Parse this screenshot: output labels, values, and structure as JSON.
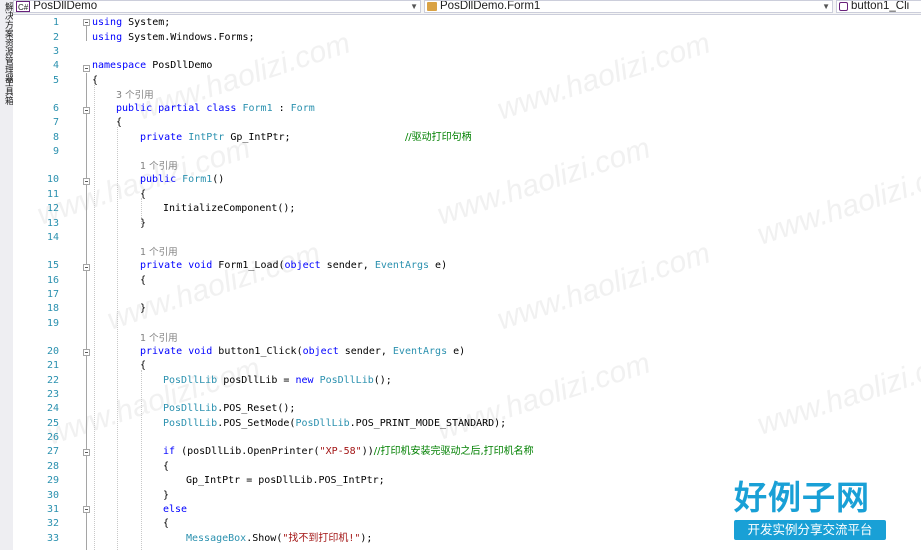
{
  "toolstrip": {
    "labels": [
      "解决方案资源管理器",
      "工具箱"
    ]
  },
  "navbar": {
    "project": {
      "icon": "csharp-project-icon",
      "badge": "C#",
      "label": "PosDllDemo"
    },
    "type": {
      "icon": "class-icon",
      "label": "PosDllDemo.Form1"
    },
    "member": {
      "icon": "event-method-icon",
      "label": "button1_Cli"
    }
  },
  "editor": {
    "line_numbers": [
      "1",
      "2",
      "3",
      "4",
      "5",
      "6",
      "7",
      "8",
      "9",
      "10",
      "11",
      "12",
      "13",
      "14",
      "15",
      "16",
      "17",
      "18",
      "19",
      "20",
      "21",
      "22",
      "23",
      "24",
      "25",
      "26",
      "27",
      "28",
      "29",
      "30",
      "31",
      "32",
      "33"
    ],
    "codelens": [
      "3 个引用",
      "1 个引用",
      "1 个引用",
      "1 个引用"
    ],
    "tokens": {
      "l1a": "using",
      "l1b": " System;",
      "l2a": "using",
      "l2b": " System.Windows.Forms;",
      "l4a": "namespace",
      "l4b": " PosDllDemo",
      "l5": "{",
      "l6a": "public",
      "l6b": " ",
      "l6c": "partial",
      "l6d": " ",
      "l6e": "class",
      "l6f": " ",
      "l6g": "Form1",
      "l6h": " : ",
      "l6i": "Form",
      "l7": "{",
      "l8a": "private",
      "l8b": " ",
      "l8c": "IntPtr",
      "l8d": " Gp_IntPtr;                   ",
      "l8e": "//驱动打印句柄",
      "l10a": "public",
      "l10b": " ",
      "l10c": "Form1",
      "l10d": "()",
      "l11": "{",
      "l12": "InitializeComponent();",
      "l13": "}",
      "l15a": "private",
      "l15b": " ",
      "l15c": "void",
      "l15d": " Form1_Load(",
      "l15e": "object",
      "l15f": " sender, ",
      "l15g": "EventArgs",
      "l15h": " e)",
      "l16": "{",
      "l18": "}",
      "l20a": "private",
      "l20b": " ",
      "l20c": "void",
      "l20d": " button1_Click(",
      "l20e": "object",
      "l20f": " sender, ",
      "l20g": "EventArgs",
      "l20h": " e)",
      "l21": "{",
      "l22a": "PosDllLib",
      "l22b": " posDllLib = ",
      "l22c": "new",
      "l22d": " ",
      "l22e": "PosDllLib",
      "l22f": "();",
      "l24a": "PosDllLib",
      "l24b": ".POS_Reset();",
      "l25a": "PosDllLib",
      "l25b": ".POS_SetMode(",
      "l25c": "PosDllLib",
      "l25d": ".POS_PRINT_MODE_STANDARD);",
      "l27a": "if",
      "l27b": " (posDllLib.OpenPrinter(",
      "l27c": "\"XP-58\"",
      "l27d": "))",
      "l27e": "//打印机安装完驱动之后,打印机名称",
      "l28": "{",
      "l29a": "Gp_IntPtr = ",
      "l29b": "posDllLib",
      "l29c": ".POS_IntPtr;",
      "l30": "}",
      "l31": "else",
      "l32": "{",
      "l33a": "MessageBox",
      "l33b": ".Show(",
      "l33c": "\"找不到打印机!\"",
      "l33d": ");"
    }
  },
  "watermark": {
    "text": "www.haolizi.com"
  },
  "logo": {
    "main": "好例子网",
    "sub": "开发实例分享交流平台"
  },
  "colors": {
    "keyword": "#0000ff",
    "type": "#2b91af",
    "string": "#a31515",
    "comment": "#008000",
    "line_number": "#2b91af",
    "codelens": "#808080",
    "logo": "#19a0d6"
  }
}
